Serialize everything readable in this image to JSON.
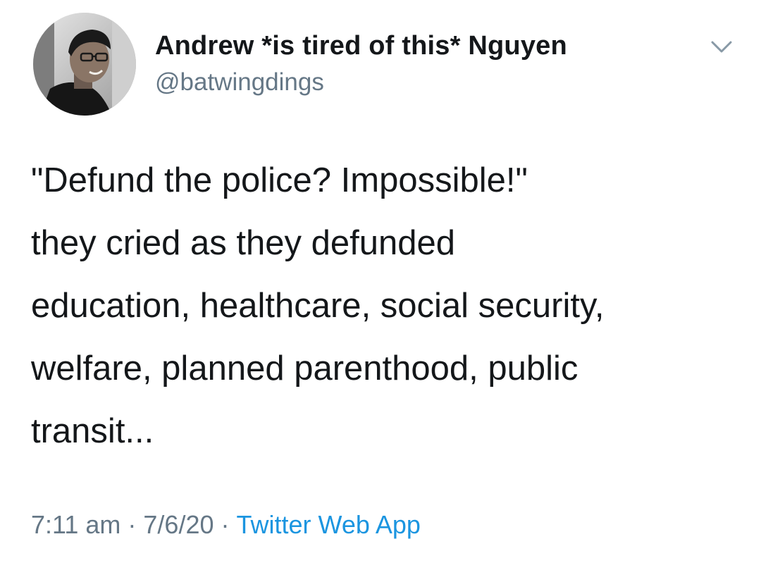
{
  "tweet": {
    "author": {
      "display_name": "Andrew *is tired of this* Nguyen",
      "handle": "@batwingdings",
      "avatar_icon": "profile-photo"
    },
    "menu_icon": "chevron-down-icon",
    "text_lines": [
      "\"Defund the police? Impossible!\"",
      "they cried as they defunded",
      "education, healthcare, social security,",
      "welfare, planned parenthood, public",
      "transit..."
    ],
    "time": "7:11 am",
    "separator": "·",
    "date": "7/6/20",
    "source": "Twitter Web App"
  },
  "colors": {
    "name": "#14171a",
    "secondary": "#657786",
    "link": "#1b95e0",
    "background": "#ffffff"
  }
}
